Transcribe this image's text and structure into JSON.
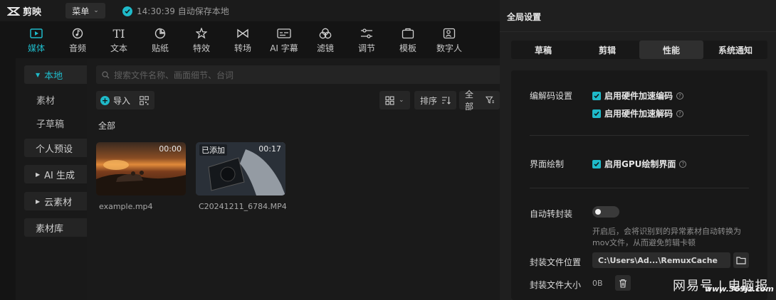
{
  "app": {
    "name": "剪映",
    "menu_label": "菜单",
    "save_status": "14:30:39 自动保存本地"
  },
  "toolbar": [
    {
      "id": "media",
      "label": "媒体",
      "icon": "media-icon",
      "active": true
    },
    {
      "id": "audio",
      "label": "音频",
      "icon": "audio-icon"
    },
    {
      "id": "text",
      "label": "文本",
      "icon": "text-icon"
    },
    {
      "id": "sticker",
      "label": "贴纸",
      "icon": "sticker-icon"
    },
    {
      "id": "effects",
      "label": "特效",
      "icon": "effects-icon"
    },
    {
      "id": "transition",
      "label": "转场",
      "icon": "transition-icon"
    },
    {
      "id": "ai-subtitle",
      "label": "AI 字幕",
      "icon": "ai-subtitle-icon"
    },
    {
      "id": "filter",
      "label": "滤镜",
      "icon": "filter-icon"
    },
    {
      "id": "adjust",
      "label": "调节",
      "icon": "adjust-icon"
    },
    {
      "id": "template",
      "label": "模板",
      "icon": "template-icon"
    },
    {
      "id": "digital-human",
      "label": "数字人",
      "icon": "digital-human-icon"
    }
  ],
  "sidebar": {
    "items": [
      {
        "label": "本地",
        "type": "group",
        "active": true
      },
      {
        "label": "素材",
        "type": "sub"
      },
      {
        "label": "子草稿",
        "type": "sub"
      },
      {
        "label": "个人预设",
        "type": "group"
      },
      {
        "label": "AI 生成",
        "type": "group"
      },
      {
        "label": "云素材",
        "type": "group"
      },
      {
        "label": "素材库",
        "type": "group"
      }
    ]
  },
  "media": {
    "search_placeholder": "搜索文件名称、画面细节、台词",
    "import_label": "导入",
    "sort_label": "排序",
    "filter_label": "全部",
    "section_label": "全部",
    "cards": [
      {
        "name": "example.mp4",
        "duration": "00:00",
        "added_label": ""
      },
      {
        "name": "C20241211_6784.MP4",
        "duration": "00:17",
        "added_label": "已添加"
      }
    ]
  },
  "settings": {
    "title": "全局设置",
    "tabs": [
      {
        "label": "草稿",
        "active": false
      },
      {
        "label": "剪辑",
        "active": false
      },
      {
        "label": "性能",
        "active": true
      },
      {
        "label": "系统通知",
        "active": false
      }
    ],
    "codec": {
      "label": "编解码设置",
      "options": [
        {
          "label": "启用硬件加速编码",
          "checked": true
        },
        {
          "label": "启用硬件加速解码",
          "checked": true
        }
      ]
    },
    "render": {
      "label": "界面绘制",
      "option": {
        "label": "启用GPU绘制界面",
        "checked": true
      }
    },
    "remux": {
      "label": "自动转封装",
      "enabled": false,
      "description": "开启后，会将识别到的异常素材自动转换为mov文件，从而避免剪辑卡顿"
    },
    "remux_location": {
      "label": "封装文件位置",
      "path": "C:\\Users\\Ad...\\RemuxCache"
    },
    "remux_size": {
      "label": "封装文件大小",
      "value": "0B"
    }
  },
  "watermark": {
    "text": "网易号 | 电脑报",
    "url": "www.369jz.com"
  },
  "colors": {
    "accent": "#1fbac9",
    "background": "#141414",
    "panel": "#1f1f1f"
  }
}
